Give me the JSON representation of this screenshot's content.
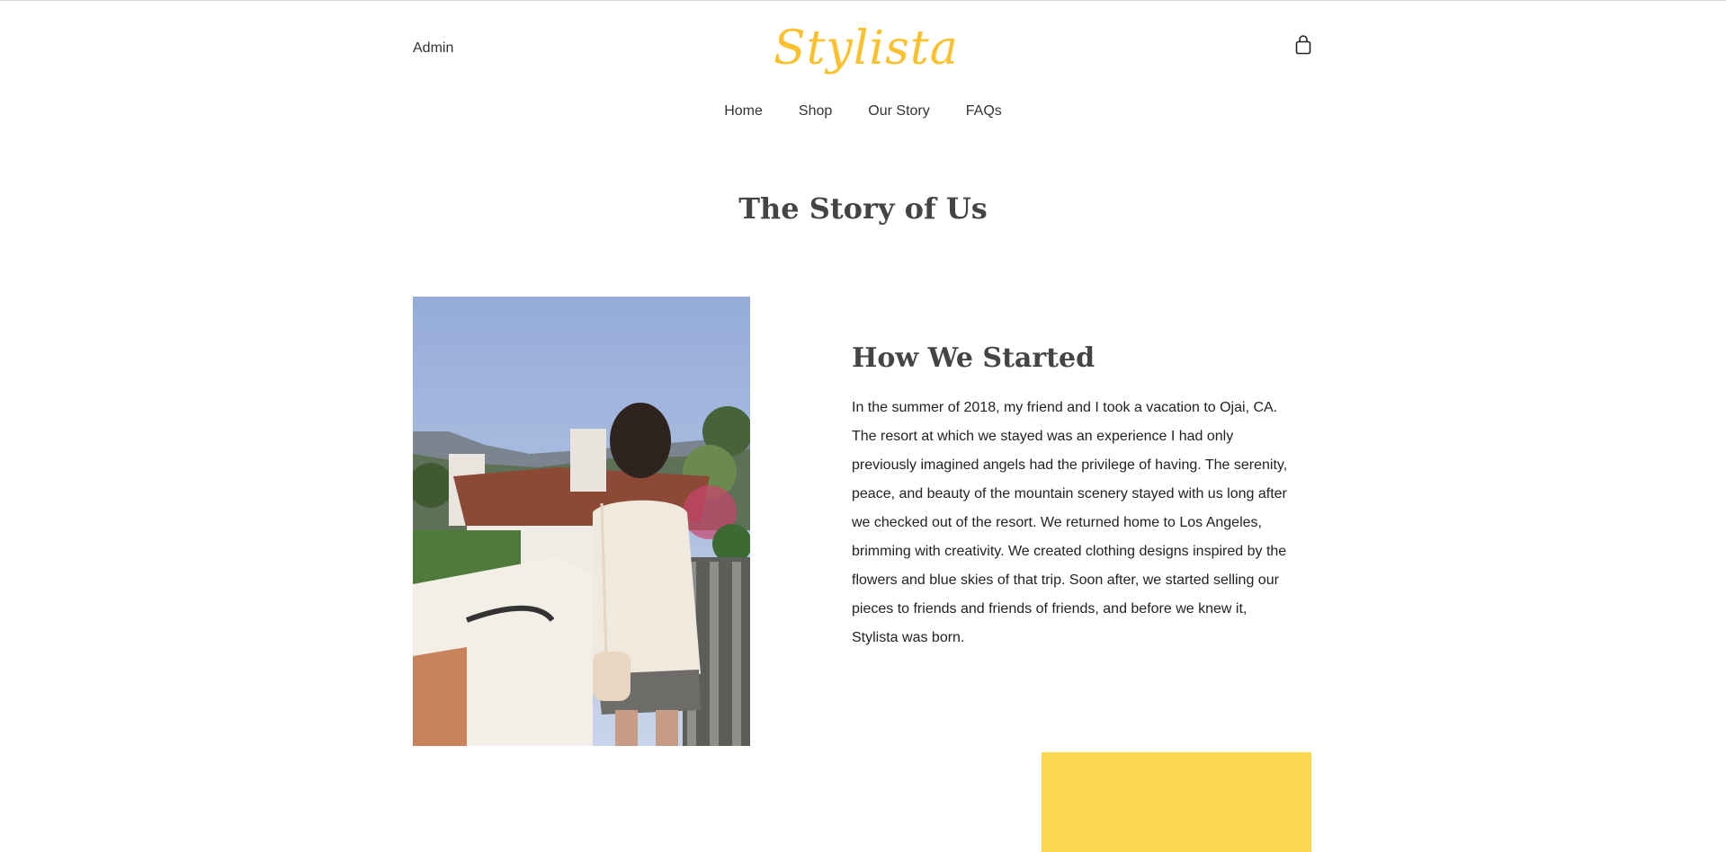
{
  "header": {
    "admin_label": "Admin",
    "logo_text": "Stylista",
    "cart_icon": "shopping-bag-icon",
    "brand_color": "#fbc02d"
  },
  "nav": {
    "items": [
      {
        "label": "Home"
      },
      {
        "label": "Shop"
      },
      {
        "label": "Our Story"
      },
      {
        "label": "FAQs"
      }
    ]
  },
  "main": {
    "page_title": "The Story of Us",
    "section": {
      "heading": "How We Started",
      "body": "In the summer of 2018, my friend and I took a vacation to Ojai, CA. The resort at which we stayed was an experience I had only previously imagined angels had the privilege of having. The serenity, peace, and beauty of the mountain scenery stayed with us long after we checked out of the resort. We returned home to Los Angeles, brimming with creativity. We created clothing designs inspired by the flowers and blue skies of that trip. Soon after, we started selling our pieces to friends and friends of friends, and before we knew it, Stylista was born."
    },
    "accent_block_color": "#fdd750"
  }
}
